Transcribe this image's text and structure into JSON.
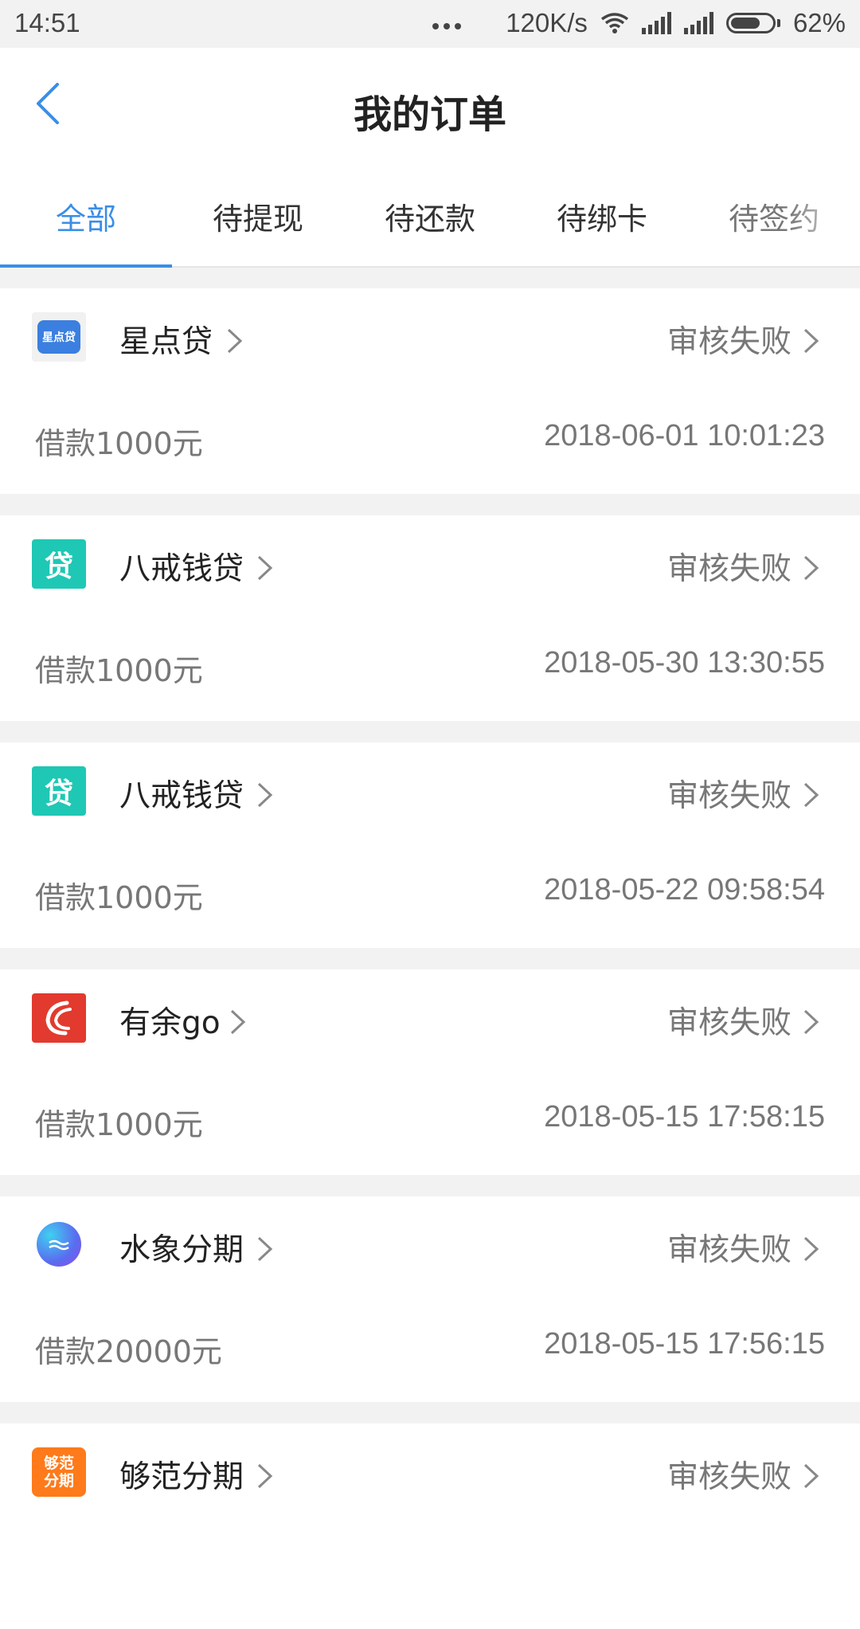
{
  "status_bar": {
    "time": "14:51",
    "network_speed": "120K/s",
    "battery": "62%"
  },
  "header": {
    "title": "我的订单"
  },
  "tabs": [
    {
      "label": "全部",
      "active": true
    },
    {
      "label": "待提现",
      "active": false
    },
    {
      "label": "待还款",
      "active": false
    },
    {
      "label": "待绑卡",
      "active": false
    },
    {
      "label": "待签约",
      "active": false
    }
  ],
  "orders": [
    {
      "app": "星点贷",
      "logo_text": "星点贷",
      "status": "审核失败",
      "amount": "借款1000元",
      "time": "2018-06-01 10:01:23",
      "icon": "xingdiandai-logo"
    },
    {
      "app": "八戒钱贷",
      "logo_text": "贷",
      "status": "审核失败",
      "amount": "借款1000元",
      "time": "2018-05-30 13:30:55",
      "icon": "bajie-logo"
    },
    {
      "app": "八戒钱贷",
      "logo_text": "贷",
      "status": "审核失败",
      "amount": "借款1000元",
      "time": "2018-05-22 09:58:54",
      "icon": "bajie-logo"
    },
    {
      "app": "有余go",
      "logo_text": "",
      "status": "审核失败",
      "amount": "借款1000元",
      "time": "2018-05-15 17:58:15",
      "icon": "youyugo-logo"
    },
    {
      "app": "水象分期",
      "logo_text": "",
      "status": "审核失败",
      "amount": "借款20000元",
      "time": "2018-05-15 17:56:15",
      "icon": "shuixiang-logo"
    },
    {
      "app": "够范分期",
      "logo_text": "够范分期",
      "status": "审核失败",
      "amount": "",
      "time": "",
      "icon": "goufan-logo"
    }
  ],
  "colors": {
    "accent": "#3a8ee6",
    "xingdiandai": "#3b7fe0",
    "bajie": "#1ec8b4",
    "youyugo": "#e23a2e",
    "goufan": "#ff7a1a"
  }
}
